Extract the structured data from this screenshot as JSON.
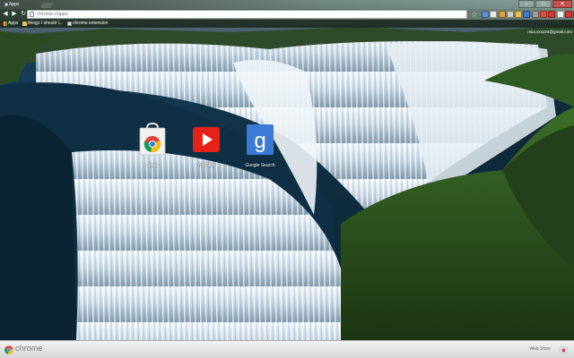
{
  "window": {
    "tab_title": "Apps",
    "minimize_glyph": "–",
    "maximize_glyph": "□",
    "close_glyph": "✕"
  },
  "toolbar": {
    "back_glyph": "◀",
    "forward_glyph": "▶",
    "reload_glyph": "↻",
    "url": "chrome://apps",
    "star_glyph": "☆",
    "extension_colors": [
      "#5a8fd8",
      "#e9e9e9",
      "#d9a23a",
      "#c9c9c9",
      "#e8c04c",
      "#3b7bd5",
      "#9b9b9b",
      "#e04c3a",
      "#d33",
      "#efefef",
      "#d33",
      "#6a6a6a"
    ]
  },
  "bookmarks": [
    {
      "label": "Apps",
      "icon": "apps-icon"
    },
    {
      "label": "things I should l...",
      "icon": "folder-icon"
    },
    {
      "label": "chrome extension",
      "icon": "page-icon"
    }
  ],
  "account": {
    "email": "nsia.xxxx24@gmail.com"
  },
  "apps": [
    {
      "label": "Store",
      "icon": "web-store-icon"
    },
    {
      "label": "YouTube",
      "icon": "youtube-icon"
    },
    {
      "label": "Google Search",
      "icon": "google-search-icon"
    }
  ],
  "footer": {
    "brand": "chrome",
    "webstore_label": "Web Store"
  },
  "colors": {
    "youtube_red": "#e62117",
    "google_blue": "#3b7bd5",
    "chrome_red": "#db4437",
    "chrome_yellow": "#f4c20d",
    "chrome_green": "#0f9d58"
  }
}
